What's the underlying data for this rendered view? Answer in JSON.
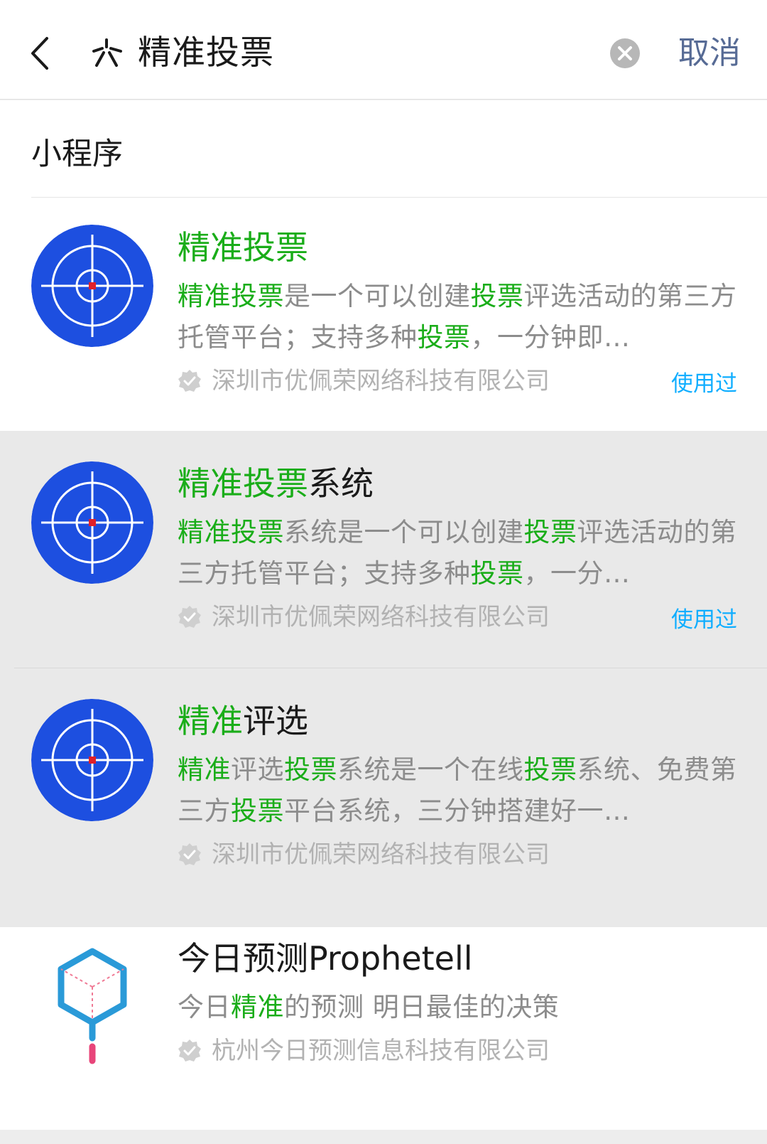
{
  "header": {
    "search_query": "精准投票",
    "cancel_label": "取消",
    "back_icon": "chevron-left-icon",
    "search_logo_icon": "wechat-search-icon",
    "clear_icon": "clear-circle-icon"
  },
  "section": {
    "title": "小程序"
  },
  "colors": {
    "highlight": "#1aad19",
    "link": "#576b95",
    "used": "#10aeff",
    "icon_blue": "#1d4fe0"
  },
  "results": [
    {
      "title": [
        {
          "text": "精准投票",
          "hl": true
        }
      ],
      "desc": [
        {
          "text": "精准投票",
          "hl": true
        },
        {
          "text": "是一个可以创建",
          "hl": false
        },
        {
          "text": "投票",
          "hl": true
        },
        {
          "text": "评选活动的第三方托管平台；支持多种",
          "hl": false
        },
        {
          "text": "投票",
          "hl": true
        },
        {
          "text": "，一分钟即…",
          "hl": false
        }
      ],
      "company": "深圳市优佩荣网络科技有限公司",
      "used": "使用过",
      "icon": "target-crosshair-icon"
    },
    {
      "title": [
        {
          "text": "精准投票",
          "hl": true
        },
        {
          "text": "系统",
          "hl": false
        }
      ],
      "desc": [
        {
          "text": "精准投票",
          "hl": true
        },
        {
          "text": "系统是一个可以创建",
          "hl": false
        },
        {
          "text": "投票",
          "hl": true
        },
        {
          "text": "评选活动的第三方托管平台；支持多种",
          "hl": false
        },
        {
          "text": "投票",
          "hl": true
        },
        {
          "text": "，一分…",
          "hl": false
        }
      ],
      "company": "深圳市优佩荣网络科技有限公司",
      "used": "使用过",
      "icon": "target-crosshair-icon"
    },
    {
      "title": [
        {
          "text": "精准",
          "hl": true
        },
        {
          "text": "评选",
          "hl": false
        }
      ],
      "desc": [
        {
          "text": "精准",
          "hl": true
        },
        {
          "text": "评选",
          "hl": false
        },
        {
          "text": "投票",
          "hl": true
        },
        {
          "text": "系统是一个在线",
          "hl": false
        },
        {
          "text": "投票",
          "hl": true
        },
        {
          "text": "系统、免费第三方",
          "hl": false
        },
        {
          "text": "投票",
          "hl": true
        },
        {
          "text": "平台系统，三分钟搭建好一…",
          "hl": false
        }
      ],
      "company": "深圳市优佩荣网络科技有限公司",
      "used": "",
      "icon": "target-crosshair-icon"
    },
    {
      "title": [
        {
          "text": "今日预测Prophetell",
          "hl": false
        }
      ],
      "desc": [
        {
          "text": "今日",
          "hl": false
        },
        {
          "text": "精准",
          "hl": true
        },
        {
          "text": "的预测 明日最佳的决策",
          "hl": false
        }
      ],
      "company": "杭州今日预测信息科技有限公司",
      "used": "",
      "icon": "hexagon-cube-pin-icon"
    }
  ]
}
